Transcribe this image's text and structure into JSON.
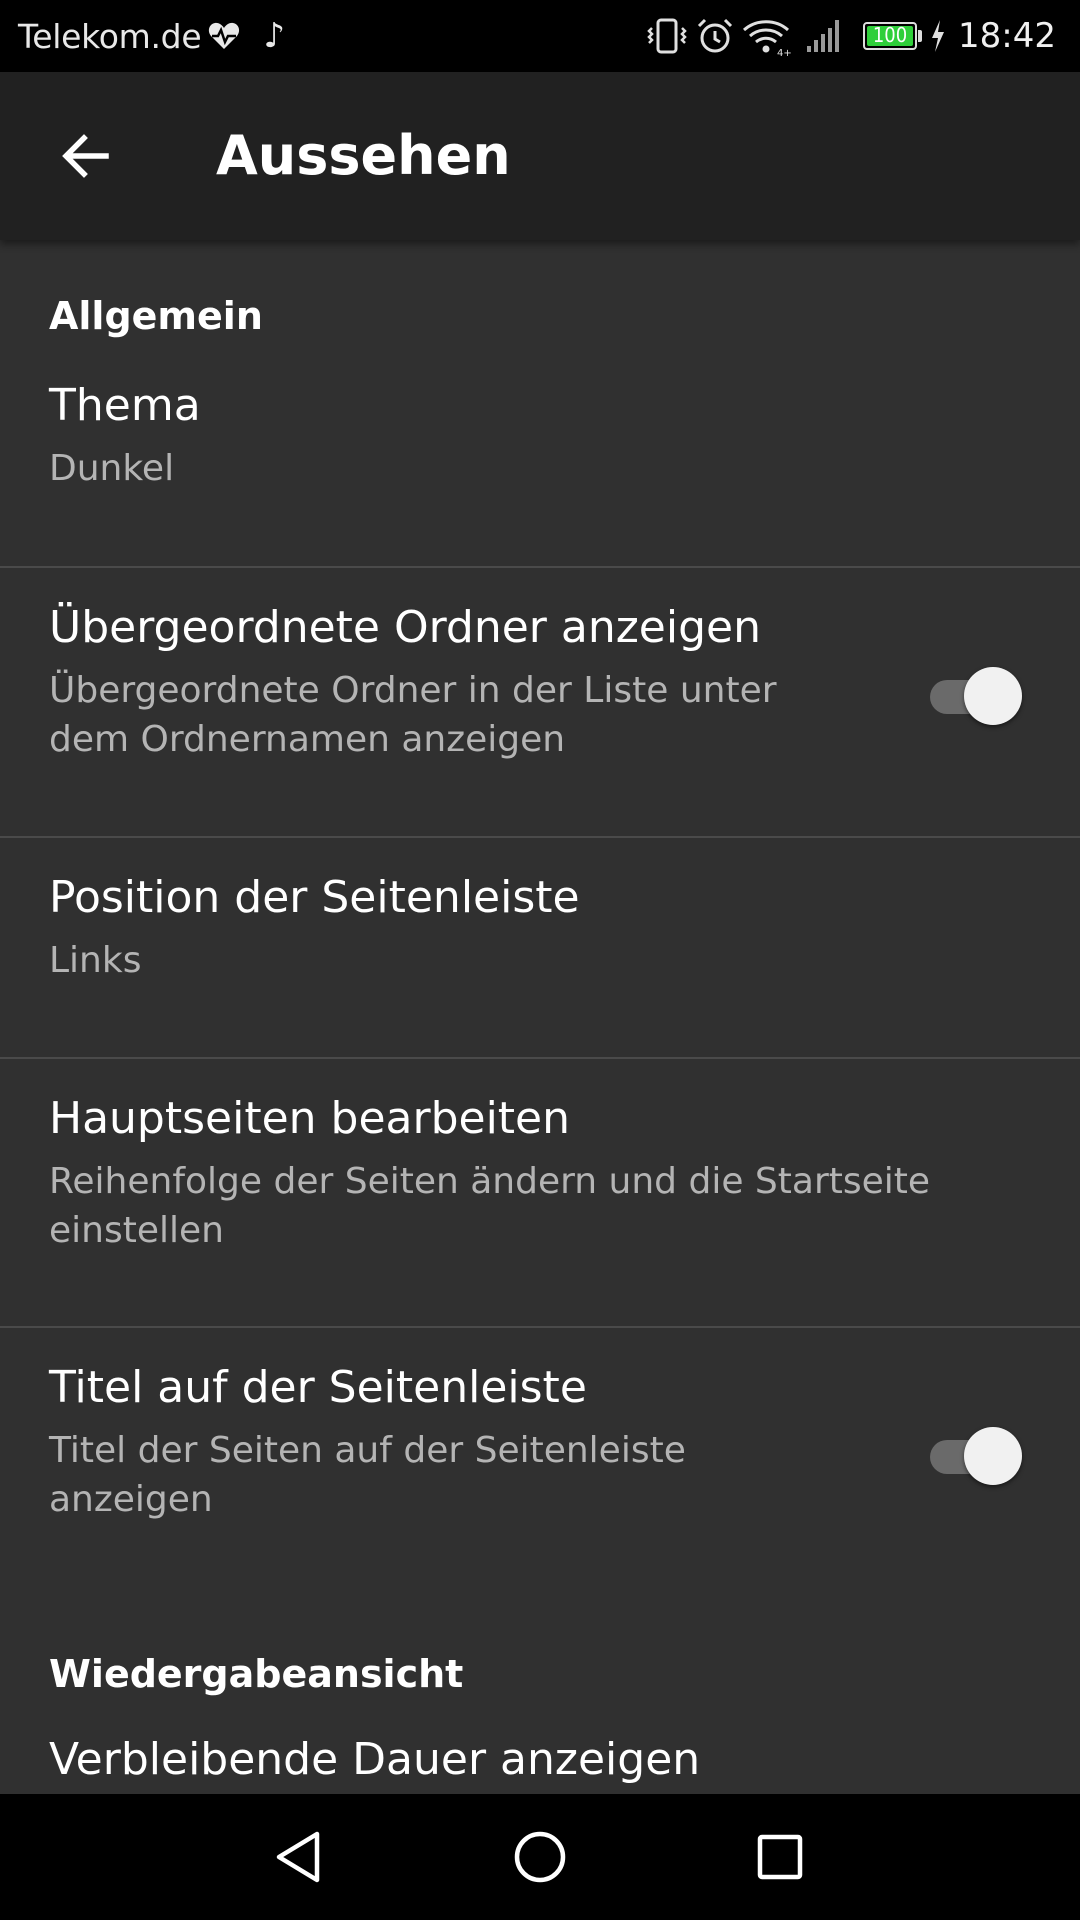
{
  "status_bar": {
    "carrier": "Telekom.de",
    "battery_level": "100",
    "time": "18:42",
    "icons": [
      "heart-icon",
      "music-note-icon",
      "vibrate-icon",
      "alarm-icon",
      "wifi-icon",
      "signal-icon",
      "battery-icon",
      "charging-icon"
    ],
    "battery_color": "#2fcf3a"
  },
  "app_bar": {
    "title": "Aussehen",
    "back_icon": "arrow-back-icon",
    "background": "#212121"
  },
  "sections": {
    "general": "Allgemein",
    "playback": "Wiedergabeansicht"
  },
  "prefs": {
    "theme": {
      "title": "Thema",
      "summary": "Dunkel"
    },
    "parent_folders": {
      "title": "Übergeordnete Ordner anzeigen",
      "summary_line1": "Übergeordnete Ordner in der Liste unter",
      "summary_line2": "dem Ordnernamen anzeigen",
      "enabled": true
    },
    "sidebar_position": {
      "title": "Position der Seitenleiste",
      "summary": "Links"
    },
    "edit_main_pages": {
      "title": "Hauptseiten bearbeiten",
      "summary_line1": "Reihenfolge der Seiten ändern und die Startseite",
      "summary_line2": "einstellen"
    },
    "sidebar_titles": {
      "title": "Titel auf der Seitenleiste",
      "summary_line1": "Titel der Seiten auf der Seitenleiste",
      "summary_line2": "anzeigen",
      "enabled": true
    },
    "remaining_duration": {
      "title": "Verbleibende Dauer anzeigen"
    }
  },
  "nav_bar": {
    "icons": [
      "nav-back-icon",
      "nav-home-icon",
      "nav-recents-icon"
    ]
  },
  "colors": {
    "background": "#303030",
    "summary_text": "#b4b4b4",
    "divider": "#4a4a4a"
  }
}
